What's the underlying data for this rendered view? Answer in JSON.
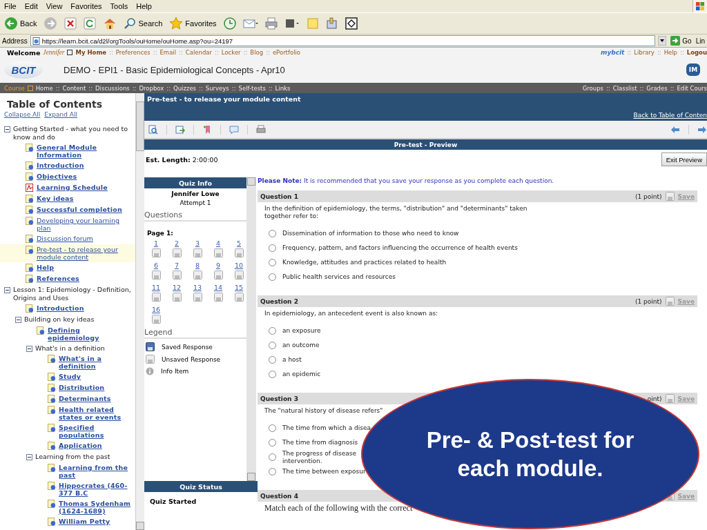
{
  "menu_bar": [
    "File",
    "Edit",
    "View",
    "Favorites",
    "Tools",
    "Help"
  ],
  "toolbar_labels": [
    "Back",
    "Search",
    "Favorites"
  ],
  "address_bar": {
    "label": "Address",
    "url": "https://learn.bcit.ca/d2l/orgTools/ouHome/ouHome.asp?ou=24197",
    "go": "Go",
    "links": "Lin"
  },
  "site_header": {
    "welcome": "Welcome",
    "user": "Jennifer",
    "separator": "::",
    "links": [
      {
        "label": "My Home",
        "bold": true
      },
      {
        "label": "Preferences",
        "bold": false
      },
      {
        "label": "Email",
        "bold": false
      },
      {
        "label": "Calendar",
        "bold": false
      },
      {
        "label": "Locker",
        "bold": false
      },
      {
        "label": "Blog",
        "bold": false
      },
      {
        "label": "ePortfolio",
        "bold": false
      }
    ],
    "portal_logo": "mybcit",
    "right_links": [
      {
        "label": "Library",
        "bold": false
      },
      {
        "label": "Help",
        "bold": false
      },
      {
        "label": "Logou",
        "bold": true
      }
    ],
    "logo": "BCIT",
    "course_title": "DEMO - EPI1 - Basic Epidemiological Concepts - Apr10",
    "badge": "IM"
  },
  "nav_bar": {
    "current": "Course",
    "separator": "::",
    "left": [
      "Home",
      "Content",
      "Discussions",
      "Dropbox",
      "Quizzes",
      "Surveys",
      "Self-tests",
      "Links"
    ],
    "right": [
      "Groups",
      "Classlist",
      "Grades",
      "Edit Cours"
    ]
  },
  "toc": {
    "title": "Table of Contents",
    "actions": [
      "Collapse All",
      "Expand All"
    ],
    "items": [
      {
        "kind": "section",
        "label": "Getting Started - what you need to know and do",
        "expanded": true,
        "children": [
          {
            "kind": "page",
            "label": "General Module Information",
            "unread": true,
            "selected": false
          },
          {
            "kind": "page",
            "label": "Introduction",
            "unread": true,
            "selected": false
          },
          {
            "kind": "page",
            "label": "Objectives",
            "unread": true,
            "selected": false
          },
          {
            "kind": "pdf",
            "label": "Learning Schedule",
            "unread": true,
            "selected": false
          },
          {
            "kind": "page",
            "label": "Key ideas",
            "unread": true,
            "selected": false
          },
          {
            "kind": "page",
            "label": "Successful completion",
            "unread": true,
            "selected": false
          },
          {
            "kind": "page",
            "label": "Developing your learning plan",
            "unread": false,
            "selected": false
          },
          {
            "kind": "page",
            "label": "Discussion forum",
            "unread": false,
            "selected": false
          },
          {
            "kind": "page",
            "label": "Pre-test - to release your module content",
            "unread": false,
            "selected": true
          },
          {
            "kind": "page",
            "label": "Help",
            "unread": true,
            "selected": false
          },
          {
            "kind": "page",
            "label": "References",
            "unread": true,
            "selected": false
          }
        ]
      },
      {
        "kind": "section",
        "label": "Lesson 1: Epidemiology - Definition, Origins and Uses",
        "expanded": true,
        "children": [
          {
            "kind": "page",
            "label": "Introduction",
            "unread": true,
            "selected": false
          },
          {
            "kind": "section",
            "label": "Building on key ideas",
            "expanded": true,
            "children": [
              {
                "kind": "page",
                "label": "Defining epidemiology",
                "unread": true,
                "selected": false
              },
              {
                "kind": "section",
                "label": "What's in a definition",
                "expanded": true,
                "children": [
                  {
                    "kind": "page",
                    "label": "What's in a definition",
                    "unread": true,
                    "selected": false
                  },
                  {
                    "kind": "page",
                    "label": "Study",
                    "unread": true,
                    "selected": false
                  },
                  {
                    "kind": "page",
                    "label": "Distribution",
                    "unread": true,
                    "selected": false
                  },
                  {
                    "kind": "page",
                    "label": "Determinants",
                    "unread": true,
                    "selected": false
                  },
                  {
                    "kind": "page",
                    "label": "Health related states or events",
                    "unread": true,
                    "selected": false
                  },
                  {
                    "kind": "page",
                    "label": "Specified populations",
                    "unread": true,
                    "selected": false
                  },
                  {
                    "kind": "page",
                    "label": "Application",
                    "unread": true,
                    "selected": false
                  }
                ]
              },
              {
                "kind": "section",
                "label": "Learning from the past",
                "expanded": true,
                "children": [
                  {
                    "kind": "page",
                    "label": "Learning from the past",
                    "unread": true,
                    "selected": false
                  },
                  {
                    "kind": "page",
                    "label": "Hippocrates (460-377 B.C",
                    "unread": true,
                    "selected": false
                  },
                  {
                    "kind": "page",
                    "label": "Thomas Sydenham (1624-1689)",
                    "unread": true,
                    "selected": false
                  },
                  {
                    "kind": "page",
                    "label": "William Petty",
                    "unread": true,
                    "selected": false
                  }
                ]
              }
            ]
          }
        ]
      }
    ]
  },
  "page": {
    "title": "Pre-test - to release your module content",
    "back_link": "Back to Table of Conten",
    "preview_title": "Pre-test - Preview",
    "est_label": "Est. Length:",
    "est_value": "2:00:00",
    "exit_button": "Exit Preview"
  },
  "quiz_info": {
    "title": "Quiz Info",
    "name": "Jennifer Lowe",
    "attempt": "Attempt 1",
    "questions_heading": "Questions",
    "page_label": "Page 1:",
    "question_links": [
      "1",
      "2",
      "3",
      "4",
      "5",
      "6",
      "7",
      "8",
      "9",
      "10",
      "11",
      "12",
      "13",
      "14",
      "15",
      "16"
    ],
    "legend_heading": "Legend",
    "legend": [
      {
        "kind": "saved",
        "label": "Saved Response"
      },
      {
        "kind": "unsaved",
        "label": "Unsaved Response"
      },
      {
        "kind": "info",
        "label": "Info Item"
      }
    ]
  },
  "quiz_status": {
    "title": "Quiz Status",
    "status": "Quiz Started"
  },
  "note": "**Please Note:** It is recommended that you save your response as you complete each question.",
  "questions": [
    {
      "title": "Question 1",
      "points": "(1 point)",
      "save": "Save",
      "text": "In the definition of epidemiology, the terms, \"distribution\" and \"determinants\" taken together refer to:",
      "serif": false,
      "options": [
        {
          "label": "Dissemination of information to those who need to know",
          "selected": false
        },
        {
          "label": "Frequency, pattern, and factors influencing the occurrence of health events",
          "selected": false
        },
        {
          "label": "Knowledge, attitudes and practices related to health",
          "selected": false
        },
        {
          "label": "Public health services and resources",
          "selected": false
        }
      ]
    },
    {
      "title": "Question 2",
      "points": "(1 point)",
      "save": "Save",
      "text": "In epidemiology, an antecedent event is also known as:",
      "serif": false,
      "options": [
        {
          "label": "an exposure",
          "selected": false
        },
        {
          "label": "an outcome",
          "selected": false
        },
        {
          "label": "a host",
          "selected": false
        },
        {
          "label": "an epidemic",
          "selected": false
        }
      ]
    },
    {
      "title": "Question 3",
      "points": "oint)",
      "save": "Save",
      "text": "The \"natural history of disease refers\"",
      "serif": false,
      "options": [
        {
          "label": "The time from which a disea",
          "selected": false
        },
        {
          "label": "The time from diagnosis",
          "selected": false
        },
        {
          "label": "The progress of disease\nintervention.",
          "selected": false
        },
        {
          "label": "The time between exposur",
          "selected": false
        }
      ]
    },
    {
      "title": "Question 4",
      "save": "Save",
      "text": "Match each of the following with the correct",
      "serif": true
    }
  ],
  "callout": {
    "text": "Pre- & Post-test for each module."
  }
}
